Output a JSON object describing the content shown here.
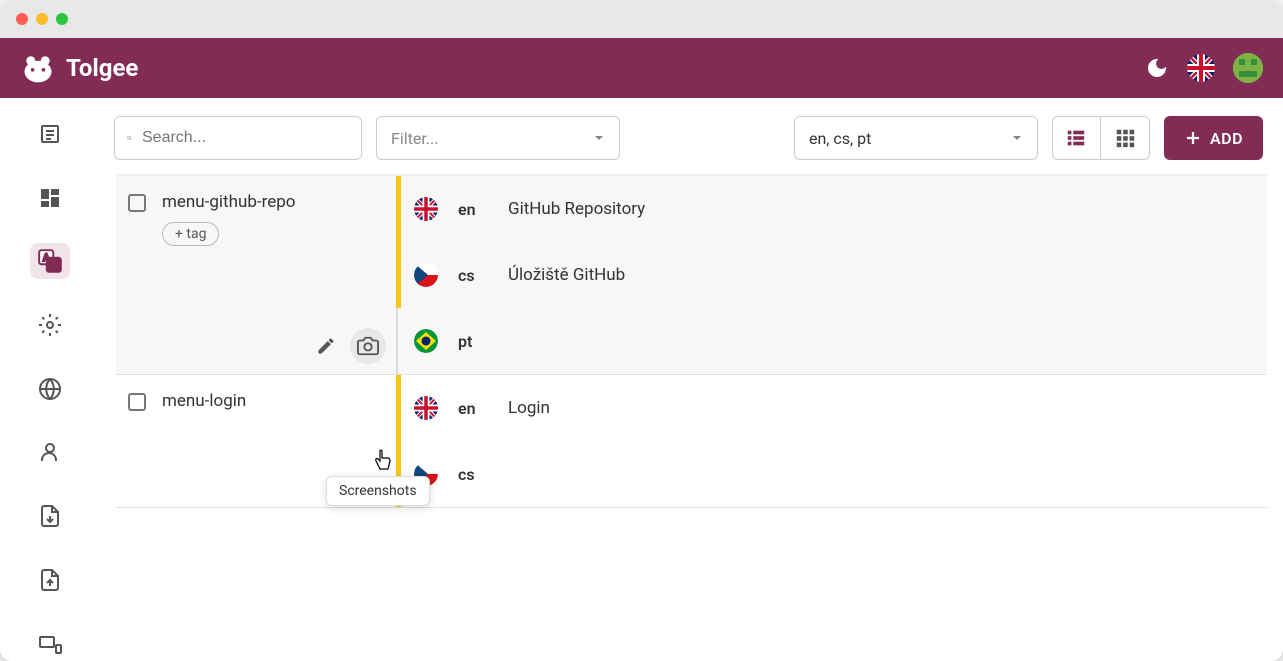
{
  "brand": {
    "name": "Tolgee"
  },
  "toolbar": {
    "search_placeholder": "Search...",
    "filter_label": "Filter...",
    "lang_select": "en, cs, pt",
    "add_label": "ADD"
  },
  "keys": [
    {
      "name": "menu-github-repo",
      "tag_label": "+ tag",
      "translations": [
        {
          "lang": "en",
          "flag": "uk",
          "text": "GitHub Repository",
          "has_value": true
        },
        {
          "lang": "cs",
          "flag": "cz",
          "text": "Úložiště GitHub",
          "has_value": true
        },
        {
          "lang": "pt",
          "flag": "br",
          "text": "",
          "has_value": false
        }
      ]
    },
    {
      "name": "menu-login",
      "translations": [
        {
          "lang": "en",
          "flag": "uk",
          "text": "Login",
          "has_value": true
        },
        {
          "lang": "cs",
          "flag": "cz",
          "text": "",
          "has_value": true
        }
      ]
    }
  ],
  "tooltip": {
    "text": "Screenshots"
  }
}
